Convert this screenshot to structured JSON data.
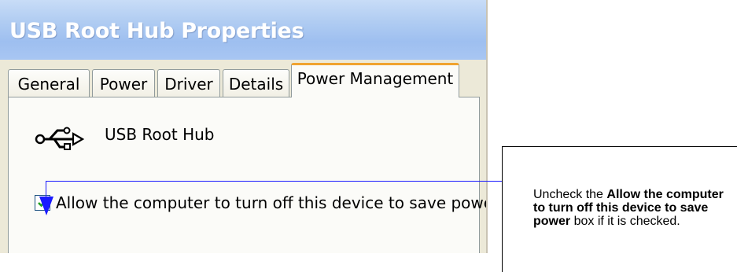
{
  "window": {
    "title": "USB Root Hub Properties"
  },
  "tabs": [
    {
      "label": "General",
      "active": false
    },
    {
      "label": "Power",
      "active": false
    },
    {
      "label": "Driver",
      "active": false
    },
    {
      "label": "Details",
      "active": false
    },
    {
      "label": "Power Management",
      "active": true
    }
  ],
  "device": {
    "icon": "usb-icon",
    "name": "USB Root Hub"
  },
  "power_option": {
    "label": "Allow the computer to turn off this device to save power.",
    "checked": true
  },
  "callout": {
    "prefix": "Uncheck the ",
    "bold": "Allow the computer to turn off this device to save power",
    "suffix": " box if it is checked.",
    "line_color": "#1a1aff"
  },
  "colors": {
    "titlebar": "#a8c6f2",
    "active_tab_accent": "#f0a330",
    "check_green": "#21a121"
  }
}
